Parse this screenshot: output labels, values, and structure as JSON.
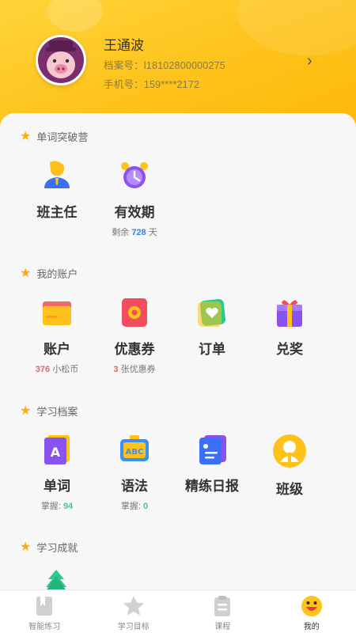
{
  "user": {
    "name": "王通波",
    "archive_label": "档案号：",
    "archive_no": "l18102800000275",
    "phone_label": "手机号：",
    "phone": "159****2172",
    "arrow": "›"
  },
  "sections": {
    "camp": {
      "title": "单词突破营",
      "items": [
        {
          "label": "班主任",
          "icon": "teacher-icon"
        },
        {
          "label": "有效期",
          "icon": "alarm-clock-icon",
          "sub_prefix": "剩余 ",
          "sub_value": "728",
          "sub_suffix": " 天"
        }
      ]
    },
    "account": {
      "title": "我的账户",
      "items": [
        {
          "label": "账户",
          "icon": "wallet-card-icon",
          "sub_value": "376",
          "sub_suffix": " 小松币"
        },
        {
          "label": "优惠券",
          "icon": "coupon-icon",
          "sub_value": "3",
          "sub_suffix": " 张优惠券"
        },
        {
          "label": "订单",
          "icon": "order-heart-icon"
        },
        {
          "label": "兑奖",
          "icon": "gift-icon"
        }
      ]
    },
    "archive": {
      "title": "学习档案",
      "items": [
        {
          "label": "单词",
          "icon": "word-book-icon",
          "sub_prefix": "掌握: ",
          "sub_value": "94"
        },
        {
          "label": "语法",
          "icon": "abc-board-icon",
          "sub_prefix": "掌握: ",
          "sub_value": "0"
        },
        {
          "label": "精练日报",
          "icon": "daily-report-icon"
        },
        {
          "label": "班级",
          "icon": "class-person-icon"
        }
      ]
    },
    "achievement": {
      "title": "学习成就",
      "icon": "tree-icon"
    }
  },
  "tabbar": {
    "tabs": [
      {
        "label": "智能练习",
        "icon": "practice-icon"
      },
      {
        "label": "学习目标",
        "icon": "star-icon"
      },
      {
        "label": "课程",
        "icon": "clipboard-icon"
      },
      {
        "label": "我的",
        "icon": "smiley-icon",
        "active": true
      }
    ]
  },
  "colors": {
    "header_yellow": "#fec21a",
    "star_orange": "#ffab10",
    "number_blue": "#3a7df6",
    "number_red": "#f06360",
    "number_green": "#4dc38a"
  }
}
